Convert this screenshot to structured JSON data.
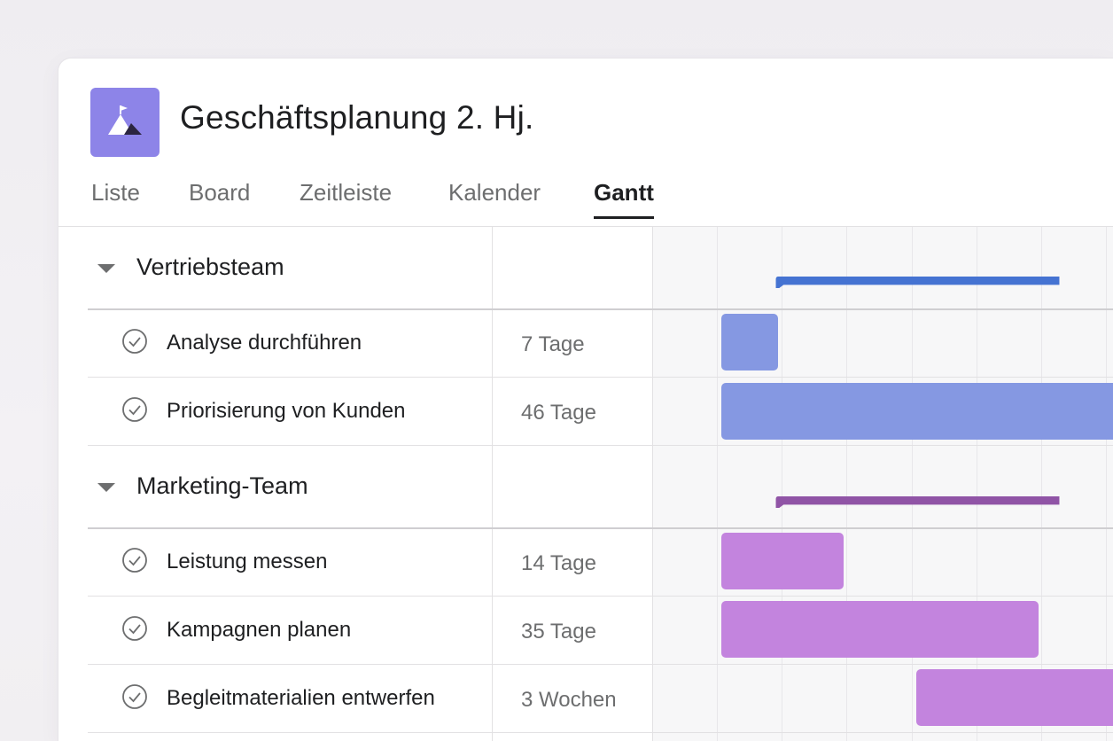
{
  "project": {
    "title": "Geschäftsplanung 2. Hj.",
    "icon": "mountain-flag-icon",
    "icon_color": "#8d84e8"
  },
  "tabs": [
    {
      "label": "Liste",
      "active": false
    },
    {
      "label": "Board",
      "active": false
    },
    {
      "label": "Zeitleiste",
      "active": false
    },
    {
      "label": "Kalender",
      "active": false
    },
    {
      "label": "Gantt",
      "active": true
    }
  ],
  "sections": [
    {
      "title": "Vertriebsteam",
      "summary_color": "#4573d2",
      "tasks": [
        {
          "name": "Analyse durchführen",
          "duration": "7 Tage",
          "bar_color": "#8598e2"
        },
        {
          "name": "Priorisierung von Kunden",
          "duration": "46 Tage",
          "bar_color": "#8598e2"
        }
      ]
    },
    {
      "title": "Marketing-Team",
      "summary_color": "#9054a6",
      "tasks": [
        {
          "name": "Leistung messen",
          "duration": "14 Tage",
          "bar_color": "#c384de"
        },
        {
          "name": "Kampagnen planen",
          "duration": "35 Tage",
          "bar_color": "#c384de"
        },
        {
          "name": "Begleitmaterialien entwerfen",
          "duration": "3 Wochen",
          "bar_color": "#c384de"
        }
      ]
    }
  ]
}
